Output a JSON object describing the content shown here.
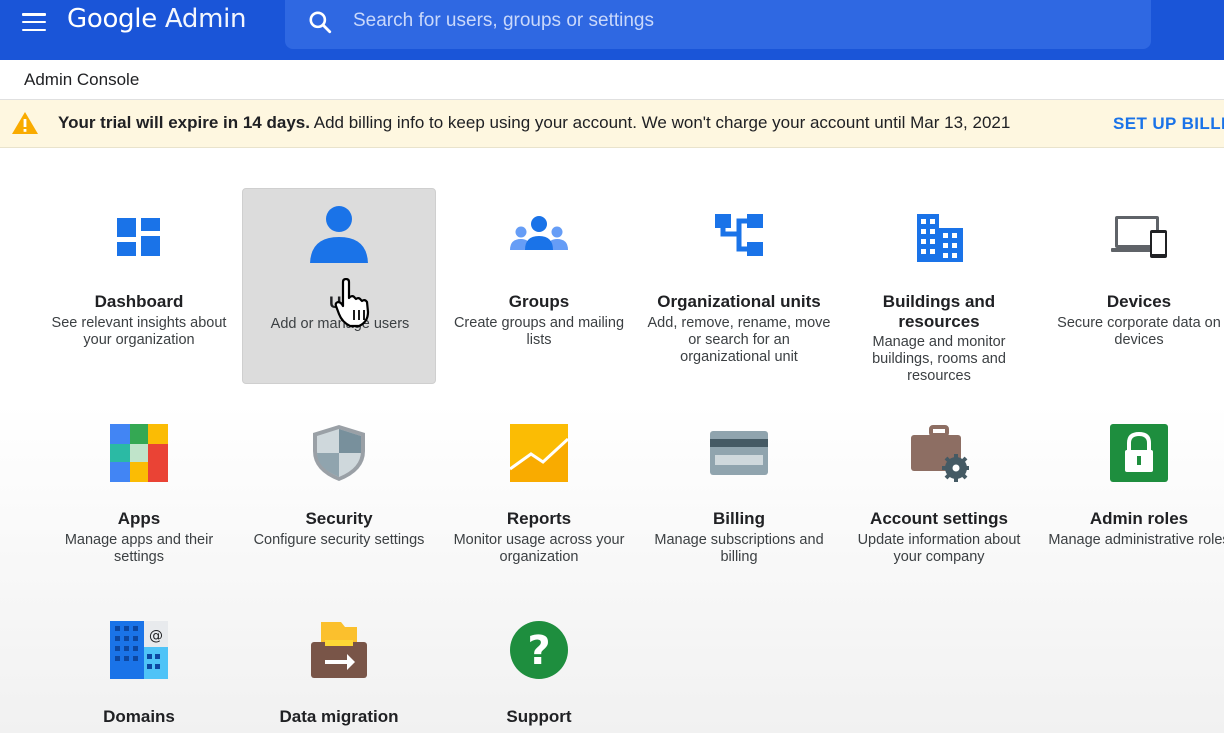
{
  "header": {
    "logo_google": "Google",
    "logo_admin": "Admin",
    "search_placeholder": "Search for users, groups or settings"
  },
  "breadcrumb": {
    "label": "Admin Console"
  },
  "banner": {
    "bold_text": "Your trial will expire in 14 days.",
    "text": " Add billing info to keep using your account. We won't charge your account until Mar 13, 2021",
    "link": "SET UP BILLIN"
  },
  "tiles": [
    {
      "title": "Dashboard",
      "desc": "See relevant insights about your organization",
      "icon": "dashboard-icon"
    },
    {
      "title": "Us",
      "desc": "Add or manage users",
      "icon": "user-icon"
    },
    {
      "title": "Groups",
      "desc": "Create groups and mailing lists",
      "icon": "groups-icon"
    },
    {
      "title": "Organizational units",
      "desc": "Add, remove, rename, move or search for an organizational unit",
      "icon": "org-units-icon"
    },
    {
      "title": "Buildings and resources",
      "desc": "Manage and monitor buildings, rooms and resources",
      "icon": "building-icon"
    },
    {
      "title": "Devices",
      "desc": "Secure corporate data on devices",
      "icon": "devices-icon"
    },
    {
      "title": "Apps",
      "desc": "Manage apps and their settings",
      "icon": "apps-icon"
    },
    {
      "title": "Security",
      "desc": "Configure security settings",
      "icon": "shield-icon"
    },
    {
      "title": "Reports",
      "desc": "Monitor usage across your organization",
      "icon": "reports-icon"
    },
    {
      "title": "Billing",
      "desc": "Manage subscriptions and billing",
      "icon": "credit-card-icon"
    },
    {
      "title": "Account settings",
      "desc": "Update information about your company",
      "icon": "briefcase-gear-icon"
    },
    {
      "title": "Admin roles",
      "desc": "Manage administrative roles",
      "icon": "lock-icon"
    },
    {
      "title": "Domains",
      "desc": "",
      "icon": "domains-icon"
    },
    {
      "title": "Data migration",
      "desc": "",
      "icon": "data-migration-icon"
    },
    {
      "title": "Support",
      "desc": "",
      "icon": "help-icon"
    }
  ],
  "colors": {
    "topbar": "#1a55d8",
    "accent": "#1a73e8",
    "banner": "#fef7e0"
  }
}
